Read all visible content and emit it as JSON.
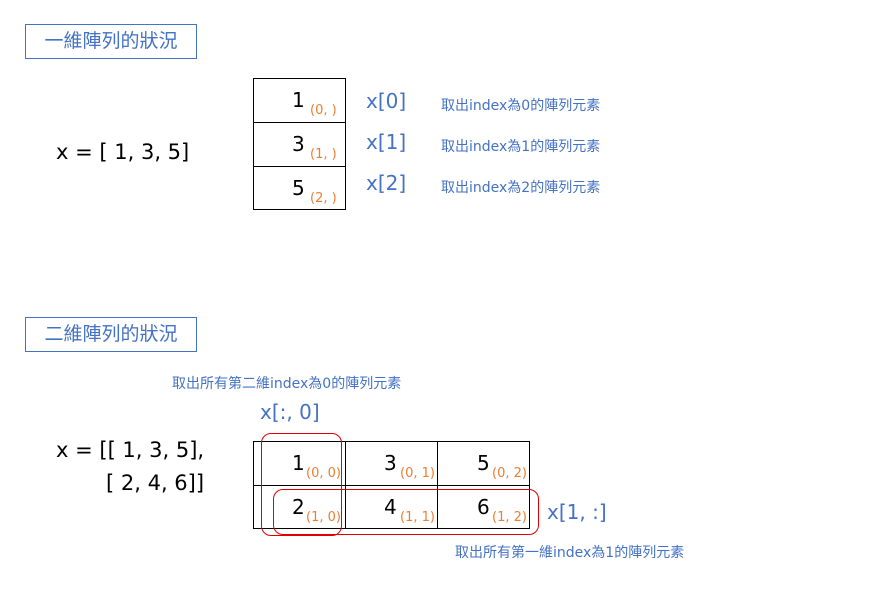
{
  "section1": {
    "title": "一維陣列的狀況",
    "code": "x = [ 1, 3, 5]",
    "cells": [
      {
        "value": "1",
        "index": "(0, )",
        "label": "x[0]",
        "note": "取出index為0的陣列元素"
      },
      {
        "value": "3",
        "index": "(1, )",
        "label": "x[1]",
        "note": "取出index為1的陣列元素"
      },
      {
        "value": "5",
        "index": "(2, )",
        "label": "x[2]",
        "note": "取出index為2的陣列元素"
      }
    ]
  },
  "section2": {
    "title": "二維陣列的狀況",
    "code_line1": "x = [[ 1, 3, 5],",
    "code_line2": "[ 2, 4, 6]]",
    "column_note": "取出所有第二維index為0的陣列元素",
    "column_label": "x[:, 0]",
    "row_label": "x[1, :]",
    "row_note": "取出所有第一維index為1的陣列元素",
    "rows": [
      [
        {
          "value": "1",
          "index": "(0, 0)"
        },
        {
          "value": "3",
          "index": "(0, 1)"
        },
        {
          "value": "5",
          "index": "(0, 2)"
        }
      ],
      [
        {
          "value": "2",
          "index": "(1, 0)"
        },
        {
          "value": "4",
          "index": "(1, 1)"
        },
        {
          "value": "6",
          "index": "(1, 2)"
        }
      ]
    ]
  }
}
